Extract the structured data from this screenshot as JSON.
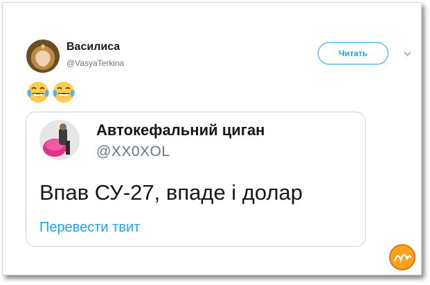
{
  "tweet": {
    "display_name": "Василиса",
    "handle": "@VasyaTerkina",
    "follow_label": "Читать"
  },
  "quoted": {
    "display_name": "Автокефальний циган",
    "handle": "@XX0XOL",
    "text": "Впав СУ-27, впаде і долар",
    "translate_label": "Перевести твит"
  },
  "icons": {
    "emoji": "face-with-tears-of-joy-icon",
    "menu": "chevron-down-icon",
    "watermark": "logo"
  },
  "colors": {
    "accent": "#1da1f2",
    "text": "#14171a",
    "muted": "#657786"
  }
}
